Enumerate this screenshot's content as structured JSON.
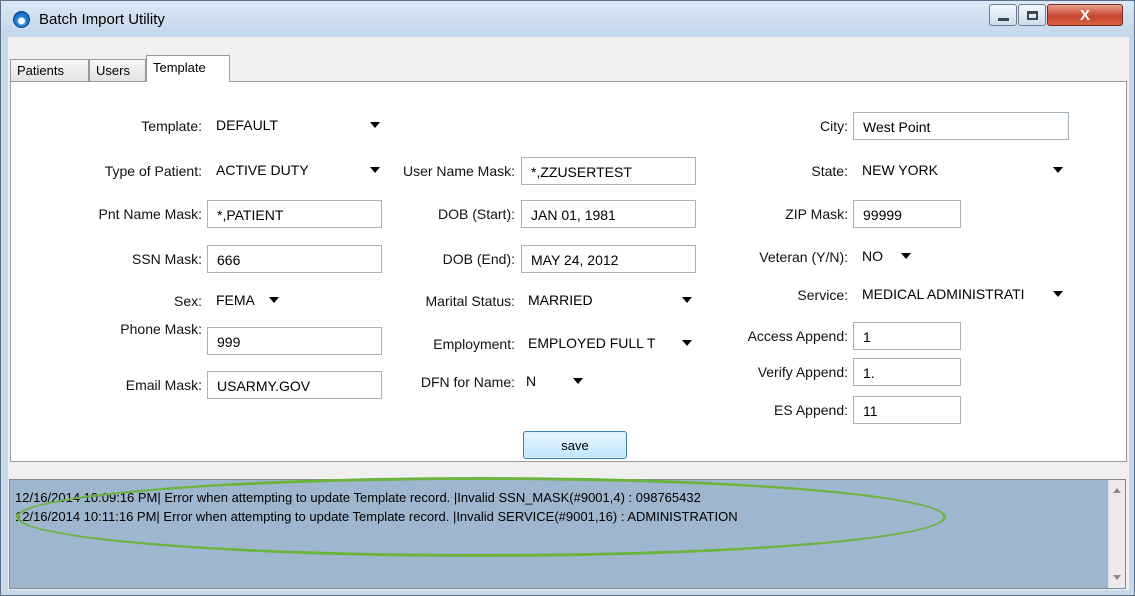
{
  "window": {
    "title": "Batch Import Utility",
    "close_glyph": "X"
  },
  "tabs": [
    {
      "label": "Patients"
    },
    {
      "label": "Users"
    },
    {
      "label": "Template"
    }
  ],
  "form": {
    "template": {
      "label": "Template:",
      "value": "DEFAULT"
    },
    "type_of_patient": {
      "label": "Type of Patient:",
      "value": "ACTIVE DUTY"
    },
    "pnt_name_mask": {
      "label": "Pnt Name Mask:",
      "value": "*,PATIENT"
    },
    "ssn_mask": {
      "label": "SSN Mask:",
      "value": "666"
    },
    "sex": {
      "label": "Sex:",
      "value": "FEMA"
    },
    "phone_mask": {
      "label": "Phone Mask:",
      "value": "999"
    },
    "email_mask": {
      "label": "Email Mask:",
      "value": "USARMY.GOV"
    },
    "user_name_mask": {
      "label": "User Name Mask:",
      "value": "*,ZZUSERTEST"
    },
    "dob_start": {
      "label": "DOB (Start):",
      "value": "JAN 01, 1981"
    },
    "dob_end": {
      "label": "DOB (End):",
      "value": "MAY 24, 2012"
    },
    "marital_status": {
      "label": "Marital Status:",
      "value": "MARRIED"
    },
    "employment": {
      "label": "Employment:",
      "value": "EMPLOYED FULL T"
    },
    "dfn_for_name": {
      "label": "DFN for Name:",
      "value": "N"
    },
    "city": {
      "label": "City:",
      "value": "West Point"
    },
    "state": {
      "label": "State:",
      "value": "NEW YORK"
    },
    "zip_mask": {
      "label": "ZIP Mask:",
      "value": "99999"
    },
    "veteran": {
      "label": "Veteran (Y/N):",
      "value": "NO"
    },
    "service": {
      "label": "Service:",
      "value": "MEDICAL ADMINISTRATI"
    },
    "access_append": {
      "label": "Access Append:",
      "value": "1"
    },
    "verify_append": {
      "label": "Verify Append:",
      "value": "1."
    },
    "es_append": {
      "label": "ES Append:",
      "value": "11"
    },
    "save_label": "save"
  },
  "log": {
    "lines": [
      "12/16/2014 10:09:16 PM| Error when attempting to update Template record.  |Invalid SSN_MASK(#9001,4) : 098765432",
      "12/16/2014 10:11:16 PM| Error when attempting to update Template record.  |Invalid SERVICE(#9001,16) : ADMINISTRATION"
    ]
  },
  "colors": {
    "log_background": "#9fb6cf",
    "highlight_ellipse": "#6db33f",
    "titlebar": "#c3d6ea"
  }
}
